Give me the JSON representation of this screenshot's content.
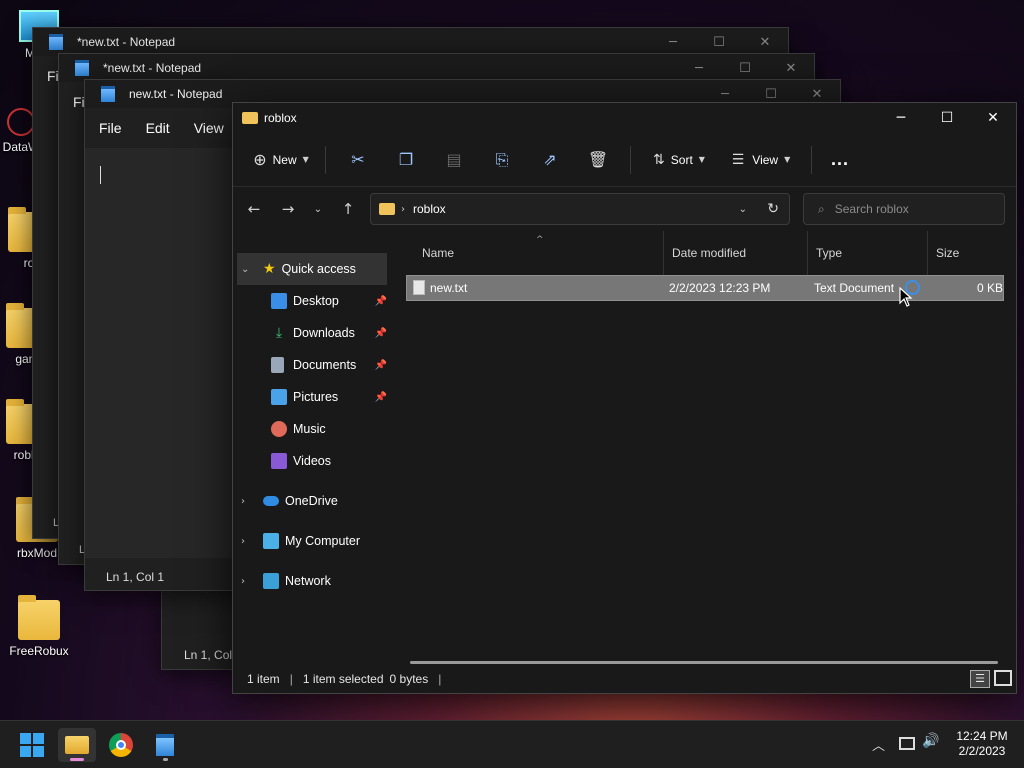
{
  "desktop": {
    "icons": [
      {
        "label": "My C",
        "icon": "computer-icon"
      },
      {
        "label": "DataW",
        "icon": "app-icon"
      },
      {
        "label": "ro",
        "icon": "folder-icon"
      },
      {
        "label": "gam",
        "icon": "folder-icon"
      },
      {
        "label": "roblo",
        "icon": "folder-icon"
      },
      {
        "label": "rbxMod",
        "icon": "folder-icon"
      },
      {
        "label": "FreeRobux",
        "icon": "folder-icon"
      }
    ]
  },
  "notepad_windows": [
    {
      "title": "*new.txt - Notepad",
      "menu_stub": "Fil"
    },
    {
      "title": "*new.txt - Notepad",
      "menu_stub": "Fil"
    },
    {
      "title": "new.txt - Notepad",
      "menu": [
        "File",
        "Edit",
        "View"
      ],
      "status": "Ln 1, Col 1"
    }
  ],
  "notepad_back_status": "Ln 1, Col",
  "notepad_side_stubs": [
    "L",
    "L"
  ],
  "explorer": {
    "title": "roblox",
    "commands": {
      "new": "New",
      "sort": "Sort",
      "view": "View",
      "more": "..."
    },
    "address": {
      "crumb": "roblox"
    },
    "search_placeholder": "Search roblox",
    "nav": {
      "quick_access": "Quick access",
      "items": [
        {
          "label": "Desktop",
          "pinned": true,
          "color": "#3a8ee6"
        },
        {
          "label": "Downloads",
          "pinned": true,
          "color": "#3dbf72"
        },
        {
          "label": "Documents",
          "pinned": true,
          "color": "#9aa7b8"
        },
        {
          "label": "Pictures",
          "pinned": true,
          "color": "#4aa3e8"
        },
        {
          "label": "Music",
          "pinned": false,
          "color": "#e06a5a"
        },
        {
          "label": "Videos",
          "pinned": false,
          "color": "#8a5ad6"
        }
      ],
      "onedrive": "OneDrive",
      "my_computer": "My Computer",
      "network": "Network"
    },
    "columns": {
      "name": "Name",
      "date": "Date modified",
      "type": "Type",
      "size": "Size"
    },
    "files": [
      {
        "name": "new.txt",
        "date": "2/2/2023 12:23 PM",
        "type": "Text Document",
        "size": "0 KB"
      }
    ],
    "status": {
      "count": "1 item",
      "selected": "1 item selected",
      "size": "0 bytes"
    }
  },
  "taskbar": {
    "time": "12:24 PM",
    "date": "2/2/2023"
  }
}
